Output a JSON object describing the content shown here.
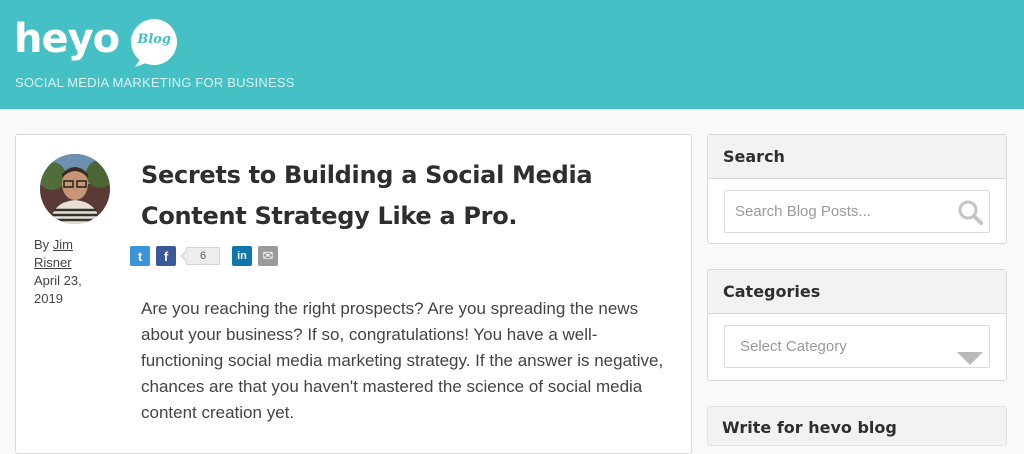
{
  "header": {
    "logo_text": "heyo",
    "logo_badge": "Blog",
    "tagline": "SOCIAL MEDIA MARKETING FOR BUSINESS",
    "bg_color": "#45c0c4"
  },
  "post": {
    "title": "Secrets to Building a Social Media Content Strategy Like a Pro.",
    "by_prefix": "By",
    "author": "Jim Risner",
    "date": "April 23, 2019",
    "share": {
      "twitter_icon": "t",
      "facebook_icon": "f",
      "facebook_count": "6",
      "linkedin_icon": "in",
      "email_icon": "✉"
    },
    "body": "Are you reaching the right prospects? Are you spreading the news about your business? If so, congratulations! You have a well-functioning social media marketing strategy. If the answer is negative, chances are that you haven't mastered the science of social media content creation yet."
  },
  "sidebar": {
    "search": {
      "title": "Search",
      "placeholder": "Search Blog Posts..."
    },
    "categories": {
      "title": "Categories",
      "selected": "Select Category"
    },
    "write": {
      "title": "Write for hevo blog"
    }
  }
}
